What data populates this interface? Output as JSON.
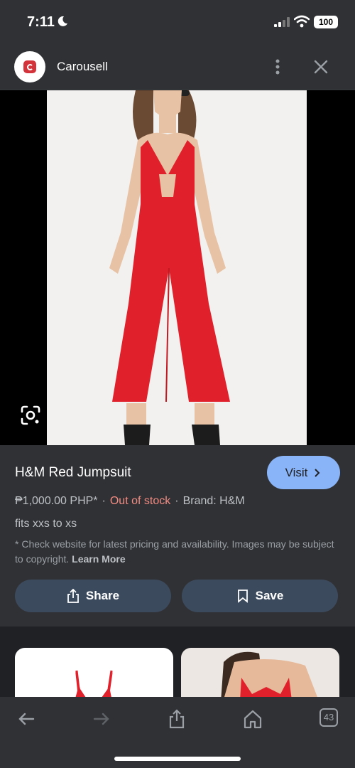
{
  "status_bar": {
    "time": "7:11",
    "battery": "100"
  },
  "header": {
    "site_name": "Carousell"
  },
  "product": {
    "title": "H&M Red Jumpsuit",
    "visit_label": "Visit",
    "price": "₱1,000.00 PHP*",
    "stock": "Out of stock",
    "brand": "Brand: H&M",
    "description": "fits xxs to xs",
    "disclaimer": "* Check website for latest pricing and availability. Images may be subject to copyright.",
    "learn_more": "Learn More",
    "share_label": "Share",
    "save_label": "Save"
  },
  "toolbar": {
    "tab_count": "43"
  },
  "colors": {
    "accent": "#8ab4f8",
    "out_of_stock": "#f28b82",
    "garment": "#e0202a"
  }
}
